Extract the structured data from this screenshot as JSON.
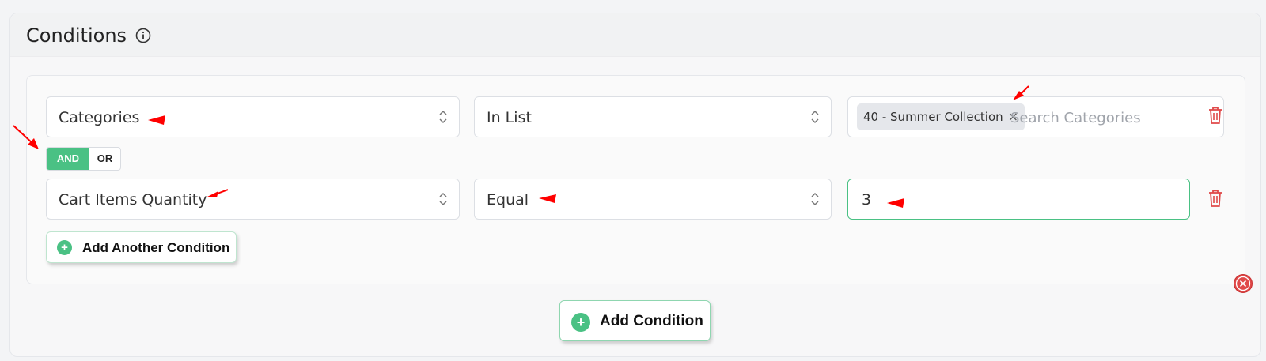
{
  "panel": {
    "title": "Conditions",
    "info_icon": "info-circle-icon"
  },
  "rows": [
    {
      "field": "Categories",
      "operator": "In List",
      "value_tags": [
        "40 - Summer Collection"
      ],
      "tag_remove": "×",
      "search_placeholder": "Search Categories"
    },
    {
      "field": "Cart Items Quantity",
      "operator": "Equal",
      "value": "3"
    }
  ],
  "logic": {
    "and_label": "AND",
    "or_label": "OR",
    "selected": "AND"
  },
  "buttons": {
    "add_another_condition": "Add Another Condition",
    "add_condition": "Add Condition"
  },
  "colors": {
    "accent_green": "#4ac184",
    "delete_red": "#e04a4a",
    "annotation_red": "#ff0000"
  }
}
